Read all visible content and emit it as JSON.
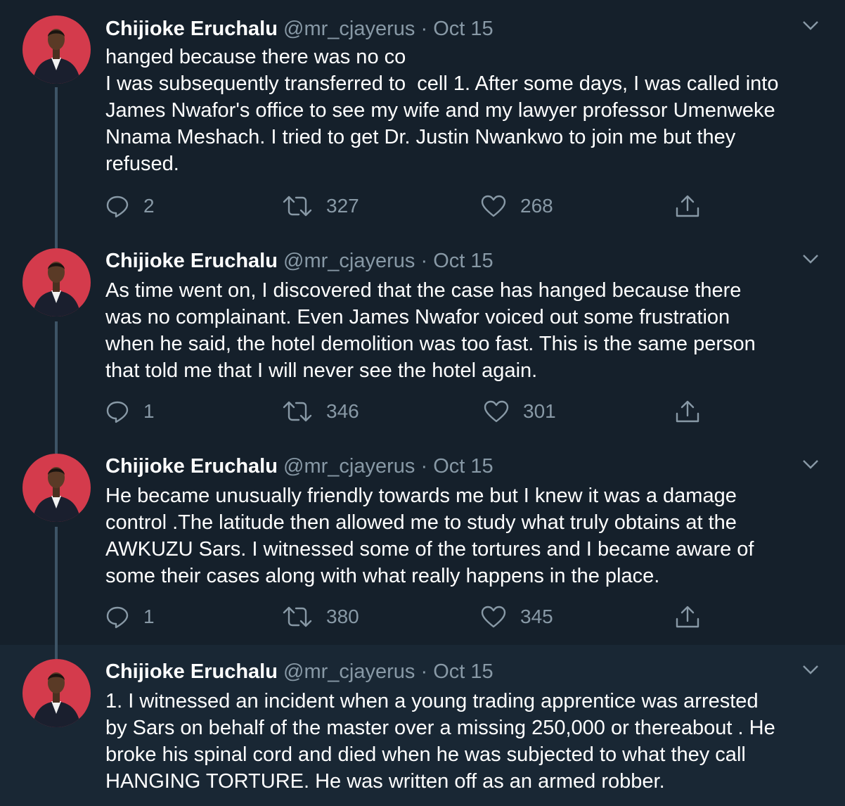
{
  "tweets": [
    {
      "name": "Chijioke Eruchalu",
      "handle": "@mr_cjayerus",
      "date": "Oct 15",
      "lines": [
        "hanged because there was no co",
        "I was subsequently transferred to  cell 1. After some days, I was called into",
        "James Nwafor's office to see my wife and my lawyer professor Umenweke",
        "Nnama Meshach. I tried to get Dr. Justin Nwankwo to join me but they",
        "refused."
      ],
      "replies": "2",
      "retweets": "327",
      "likes": "268"
    },
    {
      "name": "Chijioke Eruchalu",
      "handle": "@mr_cjayerus",
      "date": "Oct 15",
      "lines": [
        "As time went on, I discovered that the case has hanged because there",
        "was no complainant. Even James Nwafor voiced out some frustration",
        "when he said, the hotel demolition was too fast. This is the same person",
        "that told me that I will never see the hotel again."
      ],
      "replies": "1",
      "retweets": "346",
      "likes": "301"
    },
    {
      "name": "Chijioke Eruchalu",
      "handle": "@mr_cjayerus",
      "date": "Oct 15",
      "lines": [
        "He became unusually friendly towards me but I knew it was a damage",
        "control .The latitude then allowed me to study what truly obtains at the",
        "AWKUZU Sars. I witnessed some of the tortures and I became aware of",
        "some their cases along with what really happens in the place."
      ],
      "replies": "1",
      "retweets": "380",
      "likes": "345"
    },
    {
      "name": "Chijioke Eruchalu",
      "handle": "@mr_cjayerus",
      "date": "Oct 15",
      "lines": [
        "1. I witnessed an incident when a young trading apprentice was arrested",
        "by Sars on behalf of the master over a missing 250,000 or thereabout . He",
        "broke his spinal cord and died when he was subjected to what they call",
        "HANGING TORTURE. He was written off as an armed robber."
      ]
    }
  ],
  "separator": "·",
  "icons": {
    "reply": "reply-icon",
    "retweet": "retweet-icon",
    "like": "heart-icon",
    "share": "share-icon",
    "menu": "chevron-down-icon",
    "avatar": "avatar-photo"
  },
  "colors": {
    "background": "#15202b",
    "highlight_background": "#192734",
    "secondary_text": "#8899a6",
    "thread_line": "#3d5466",
    "avatar_bg": "#d43b4c"
  }
}
